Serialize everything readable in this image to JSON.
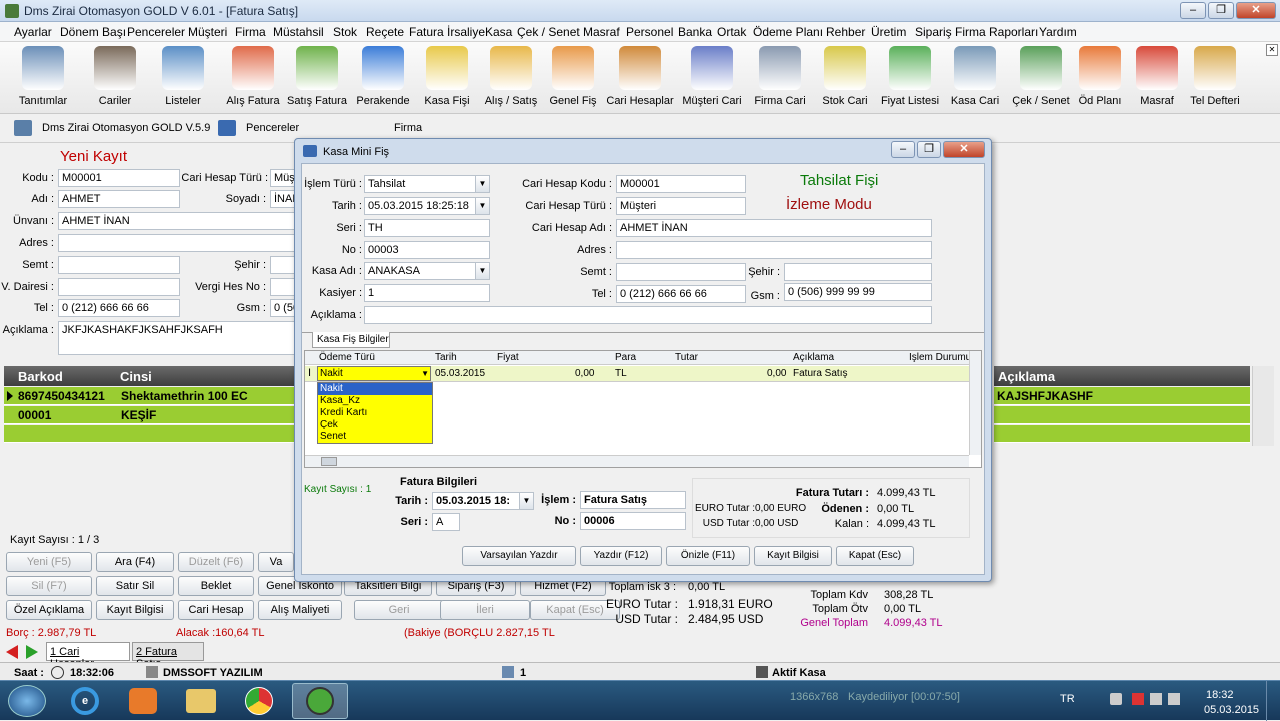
{
  "window": {
    "title": "Dms Zirai  Otomasyon GOLD V 6.01 - [Fatura Satış]"
  },
  "menu": [
    "Ayarlar",
    "Dönem Başı",
    "Pencereler",
    "Müşteri",
    "Firma",
    "Müstahsil",
    "Stok",
    "Reçete",
    "Fatura İrsaliye",
    "Kasa",
    "Çek / Senet",
    "Masraf",
    "Personel",
    "Banka",
    "Ortak",
    "Ödeme Planı",
    "Rehber",
    "Üretim",
    "Sipariş",
    "Firma Raporları",
    "Yardım"
  ],
  "toolbar": [
    {
      "label": "Tanıtımlar",
      "icon": "user-icon",
      "color": "#6b8fb8"
    },
    {
      "label": "Cariler",
      "icon": "book-icon",
      "color": "#7a6a5a"
    },
    {
      "label": "Listeler",
      "icon": "list-icon",
      "color": "#5b8fc6"
    },
    {
      "label": "Alış Fatura",
      "icon": "invoice-buy-icon",
      "color": "#e06b4a"
    },
    {
      "label": "Satış Fatura",
      "icon": "invoice-sell-icon",
      "color": "#6fb24b"
    },
    {
      "label": "Perakende",
      "icon": "cart-icon",
      "color": "#3b7dd8"
    },
    {
      "label": "Kasa Fişi",
      "icon": "receipt-icon",
      "color": "#e8c94a"
    },
    {
      "label": "Alış / Satış",
      "icon": "pen-icon",
      "color": "#e8b84a"
    },
    {
      "label": "Genel Fiş",
      "icon": "note-icon",
      "color": "#e89a4a"
    },
    {
      "label": "Cari Hesaplar",
      "icon": "people-icon",
      "color": "#d08a3a"
    },
    {
      "label": "Müşteri Cari",
      "icon": "customers-icon",
      "color": "#6a7ec8"
    },
    {
      "label": "Firma Cari",
      "icon": "factory-icon",
      "color": "#8a9ab0"
    },
    {
      "label": "Stok Cari",
      "icon": "boxes-icon",
      "color": "#d8c84a"
    },
    {
      "label": "Fiyat Listesi",
      "icon": "price-list-icon",
      "color": "#5ab05a"
    },
    {
      "label": "Kasa Cari",
      "icon": "cash-register-icon",
      "color": "#7a9ab8"
    },
    {
      "label": "Çek / Senet",
      "icon": "cheque-icon",
      "color": "#5aa05a"
    },
    {
      "label": "Öd Planı",
      "icon": "calendar-icon",
      "color": "#e87a3a"
    },
    {
      "label": "Masraf",
      "icon": "expense-icon",
      "color": "#d84a3a"
    },
    {
      "label": "Tel Defteri",
      "icon": "phonebook-icon",
      "color": "#d8a84a"
    }
  ],
  "secbar": {
    "app": "Dms Zirai Otomasyon GOLD V.5.9",
    "windows": "Pencereler",
    "firma": "Firma"
  },
  "form": {
    "heading": "Yeni Kayıt",
    "kodu_label": "Kodu :",
    "kodu": "M00001",
    "cari_hesap_turu_label": "Cari Hesap Türü :",
    "cari_hesap_turu": "Müşteri",
    "adi_label": "Adı :",
    "adi": "AHMET",
    "soyadi_label": "Soyadı :",
    "soyadi": "İNAN",
    "unvani_label": "Ünvanı :",
    "unvani": "AHMET İNAN",
    "adres_label": "Adres :",
    "semt_label": "Semt :",
    "sehir_label": "Şehir :",
    "vdairesi_label": "V. Dairesi :",
    "vergi_label": "Vergi Hes No :",
    "tel_label": "Tel :",
    "tel": "0 (212) 666 66 66",
    "gsm_label": "Gsm :",
    "gsm": "0 (50",
    "aciklama_label": "Açıklama :",
    "aciklama": "JKFJKASHAKFJKSAHFJKSAFH"
  },
  "grid": {
    "headers": [
      "Barkod",
      "Cinsi"
    ],
    "right_header": "Açıklama",
    "rows": [
      {
        "barkod": "8697450434121",
        "cinsi": "Shektamethrin 100 EC",
        "aciklama": "KAJSHFJKASHF"
      },
      {
        "barkod": "00001",
        "cinsi": "KEŞİF",
        "aciklama": ""
      }
    ]
  },
  "record_count": "Kayıt Sayısı :  1 / 3",
  "bottom_buttons": [
    [
      "Yeni (F5)",
      "Ara (F4)",
      "Düzelt (F6)",
      "Va"
    ],
    [
      "Sil (F7)",
      "Satır Sil",
      "Beklet",
      "Genel İskonto",
      "Taksitleri Bilgi",
      "Sipariş (F3)",
      "Hizmet (F2)"
    ],
    [
      "Özel Açıklama",
      "Kayıt Bilgisi",
      "Cari Hesap",
      "Alış Maliyeti",
      "Geri",
      "İleri",
      "Kapat (Esc)"
    ]
  ],
  "totals": {
    "toplam_isk_label": "Toplam isk 3 :",
    "toplam_isk": "0,00 TL",
    "euro_label": "EURO  Tutar :",
    "euro": "1.918,31 EURO",
    "usd_label": "USD Tutar :",
    "usd": "2.484,95 USD",
    "kdv_label": "Toplam Kdv",
    "kdv": "308,28 TL",
    "otv_label": "Toplam Ötv",
    "otv": "0,00 TL",
    "genel_label": "Genel Toplam",
    "genel": "4.099,43 TL",
    "borc": "Borç :  2.987,79 TL",
    "alacak": "Alacak :160,64 TL",
    "bakiye": "(Bakiye (BORÇLU 2.827,15 TL"
  },
  "tabs": [
    "1 Cari Hesaplar",
    "2 Fatura Satış"
  ],
  "status": {
    "saat_label": "Saat :",
    "saat": "18:32:06",
    "company": "DMSSOFT YAZILIM",
    "count": "1",
    "kasa": "Aktif Kasa"
  },
  "dialog": {
    "title": "Kasa Mini Fiş",
    "islem_turu_label": "İşlem Türü :",
    "islem_turu": "Tahsilat",
    "tarih_label": "Tarih :",
    "tarih": "05.03.2015 18:25:18",
    "seri_label": "Seri :",
    "seri": "TH",
    "no_label": "No :",
    "no": "00003",
    "kasa_adi_label": "Kasa Adı :",
    "kasa_adi": "ANAKASA",
    "kasiyer_label": "Kasiyer :",
    "kasiyer": "1",
    "aciklama_label": "Açıklama :",
    "cari_kodu_label": "Cari Hesap Kodu :",
    "cari_kodu": "M00001",
    "cari_turu_label": "Cari Hesap Türü :",
    "cari_turu": "Müşteri",
    "cari_adi_label": "Cari Hesap Adı :",
    "cari_adi": "AHMET İNAN",
    "adres_label": "Adres :",
    "semt_label": "Semt :",
    "sehir_label": "Şehir :",
    "tel_label": "Tel :",
    "tel": "0 (212) 666 66 66",
    "gsm_label": "Gsm :",
    "gsm": "0 (506) 999 99 99",
    "fis_title": "Tahsilat Fişi",
    "mode": "İzleme Modu",
    "tab": "Kasa Fiş Bilgiler",
    "columns": [
      "Ödeme Türü",
      "Tarih",
      "Fiyat",
      "Para",
      "Tutar",
      "Açıklama",
      "İşlem Durumu"
    ],
    "row": {
      "odeme": "Nakit",
      "tarih": "05.03.2015",
      "fiyat": "0,00",
      "para": "TL",
      "tutar": "0,00",
      "aciklama": "Fatura Satış"
    },
    "dropdown": [
      "Nakit",
      "Kasa_Kz",
      "Kredi Kartı",
      "Çek",
      "Senet"
    ],
    "kayit_sayisi": "Kayıt Sayısı : 1",
    "fatura_bilgileri": "Fatura Bilgileri",
    "f_tarih_label": "Tarih :",
    "f_tarih": "05.03.2015 18:",
    "f_islem_label": "İşlem :",
    "f_islem": "Fatura Satış",
    "f_seri_label": "Seri :",
    "f_seri": "A",
    "f_no_label": "No :",
    "f_no": "00006",
    "fatura_tutari_label": "Fatura Tutarı :",
    "fatura_tutari": "4.099,43 TL",
    "euro_label": "EURO  Tutar :",
    "euro": "0,00 EURO",
    "odenen_label": "Ödenen :",
    "odenen": "0,00 TL",
    "usd_label": "USD Tutar :",
    "usd": "0,00 USD",
    "kalan_label": "Kalan :",
    "kalan": "4.099,43 TL",
    "buttons": [
      "Varsayılan Yazdır",
      "Yazdır (F12)",
      "Önizle (F11)",
      "Kayıt Bilgisi",
      "Kapat (Esc)"
    ]
  },
  "taskbar": {
    "lang": "TR",
    "time": "18:32",
    "date": "05.03.2015",
    "resolution": "1366x768",
    "recorder": "Kaydediliyor [00:07:50]"
  }
}
